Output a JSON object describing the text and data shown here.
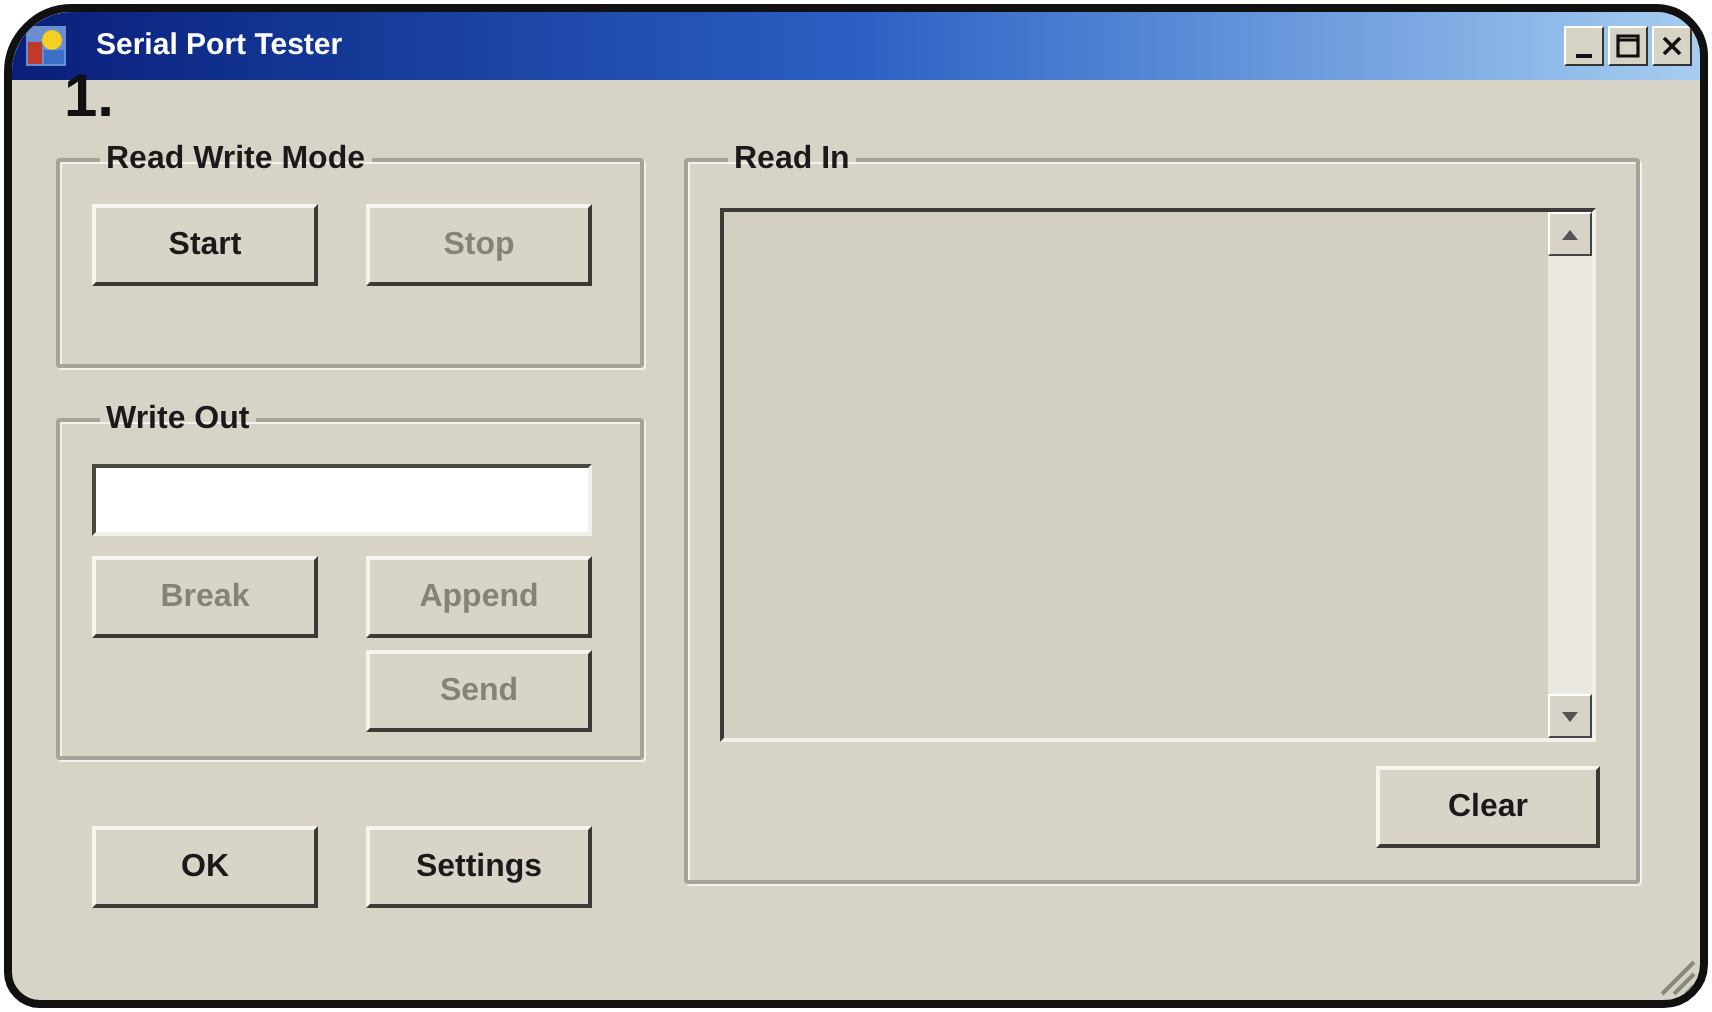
{
  "window": {
    "title": "Serial Port Tester"
  },
  "annotation": "1.",
  "read_write_mode": {
    "label": "Read Write Mode",
    "buttons": [
      {
        "label": "Start",
        "disabled": false
      },
      {
        "label": "Stop",
        "disabled": true
      }
    ]
  },
  "write_out": {
    "label": "Write Out",
    "buttons": [
      {
        "label": "Break",
        "disabled": true
      },
      {
        "label": "Append",
        "disabled": true
      },
      {
        "label": "Send",
        "disabled": true
      }
    ]
  },
  "read_in": {
    "label": "Read In",
    "buttons": [
      {
        "label": "Clear",
        "disabled": false
      }
    ]
  },
  "buttons": [
    {
      "label": "OK",
      "disabled": false
    },
    {
      "label": "Settings",
      "disabled": false
    }
  ]
}
